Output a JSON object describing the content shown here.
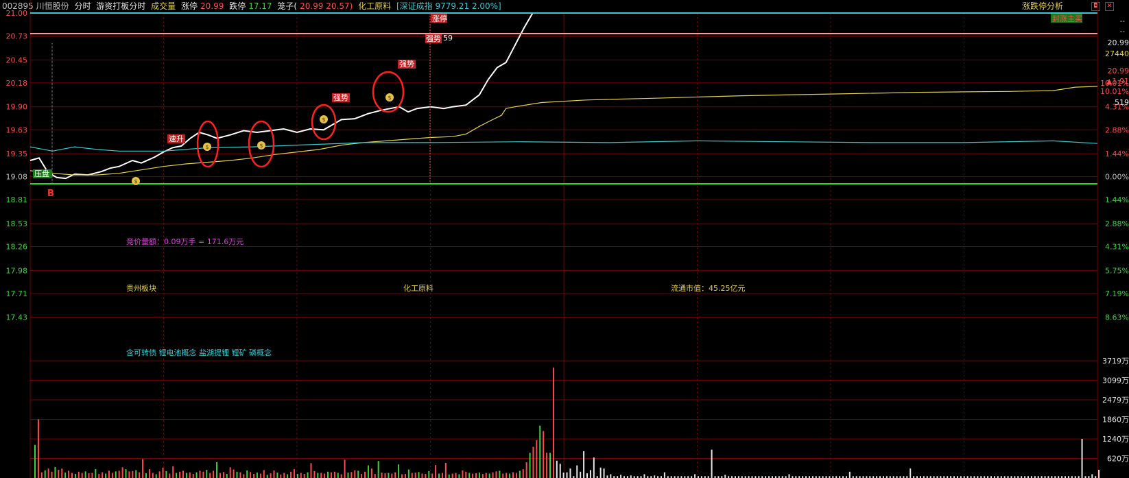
{
  "header": {
    "code": "002895 川恒股份",
    "tab_fenshi": "分时",
    "tab_youzi": "游资打板分时",
    "volume_label": "成交量",
    "zhangting_label": "涨停",
    "zhangting_value": "20.99",
    "dieting_label": "跌停",
    "dieting_value": "17.17",
    "longzi_label": "笼子(",
    "longzi_values": "20.99 20.57)",
    "sector": "化工原料",
    "index_text": "[深证成指 9779.21 2.00%]",
    "right_title": "涨跌停分析"
  },
  "colors": {
    "up": "#ff4b4b",
    "down": "#3cd23c",
    "price_line": "#ffffff",
    "avg_line": "#e6d24a",
    "cyan_line": "#39c8d2",
    "grid": "#7a0000",
    "limit_line": "#f2a0a0"
  },
  "annotations": {
    "zhangting_tag": "涨停",
    "qiangshi_top": "强势",
    "num_59": "59",
    "qiangshi_1": "强势",
    "qiangshi_2": "强势",
    "susheng": "速升",
    "yawei": "压盘",
    "b_mark": "B",
    "fengdan": "封涨主买",
    "jingjia": "竞价量额：0.09万手 = 171.6万元",
    "guizhou": "贵州板块",
    "huagong": "化工原料",
    "liutong": "流通市值：45.25亿元",
    "concepts": "含可转债 锂电池概念 盐湖提锂 锂矿 磷概念"
  },
  "right_panel": {
    "dash1": "--",
    "dash2": "--",
    "price": "20.99",
    "volume": "27440",
    "price2": "20.99",
    "change": "▲1.91",
    "pct": "10.01%",
    "num": "519"
  },
  "chart_data": {
    "type": "line",
    "pre_close": 19.08,
    "price_ticks": [
      "21.00",
      "20.73",
      "20.45",
      "20.18",
      "19.90",
      "19.63",
      "19.35",
      "19.08",
      "18.81",
      "18.53",
      "18.26",
      "17.98",
      "17.71",
      "17.43"
    ],
    "pct_ticks": [
      "",
      "",
      "",
      "10.01%",
      "4.31%",
      "2.88%",
      "1.44%",
      "0.00%",
      "1.44%",
      "2.88%",
      "4.31%",
      "5.75%",
      "7.19%",
      "8.63%"
    ],
    "ylim": [
      17.17,
      21.0
    ],
    "volume_ticks": [
      "3719万",
      "3099万",
      "2479万",
      "1860万",
      "1240万",
      "620万"
    ],
    "volume_max": 3719,
    "series": [
      {
        "kind": "price",
        "points": [
          [
            0,
            19.27
          ],
          [
            4,
            19.3
          ],
          [
            8,
            19.13
          ],
          [
            12,
            19.07
          ],
          [
            16,
            19.06
          ],
          [
            20,
            19.11
          ],
          [
            26,
            19.1
          ],
          [
            32,
            19.14
          ],
          [
            36,
            19.18
          ],
          [
            40,
            19.2
          ],
          [
            46,
            19.27
          ],
          [
            50,
            19.24
          ],
          [
            56,
            19.31
          ],
          [
            60,
            19.37
          ],
          [
            64,
            19.42
          ],
          [
            68,
            19.44
          ],
          [
            72,
            19.53
          ],
          [
            76,
            19.6
          ],
          [
            80,
            19.57
          ],
          [
            84,
            19.53
          ],
          [
            90,
            19.57
          ],
          [
            96,
            19.62
          ],
          [
            102,
            19.6
          ],
          [
            108,
            19.62
          ],
          [
            114,
            19.64
          ],
          [
            120,
            19.6
          ],
          [
            126,
            19.64
          ],
          [
            132,
            19.63
          ],
          [
            136,
            19.69
          ],
          [
            140,
            19.75
          ],
          [
            146,
            19.76
          ],
          [
            152,
            19.82
          ],
          [
            158,
            19.86
          ],
          [
            162,
            19.88
          ],
          [
            166,
            19.9
          ],
          [
            170,
            19.84
          ],
          [
            174,
            19.88
          ],
          [
            180,
            19.9
          ],
          [
            186,
            19.88
          ],
          [
            190,
            19.9
          ],
          [
            196,
            19.92
          ],
          [
            202,
            20.04
          ],
          [
            206,
            20.22
          ],
          [
            210,
            20.36
          ],
          [
            214,
            20.42
          ],
          [
            218,
            20.62
          ],
          [
            222,
            20.82
          ],
          [
            226,
            21.0
          ]
        ]
      },
      {
        "kind": "avg",
        "points": [
          [
            0,
            19.15
          ],
          [
            10,
            19.12
          ],
          [
            20,
            19.1
          ],
          [
            30,
            19.1
          ],
          [
            40,
            19.12
          ],
          [
            50,
            19.16
          ],
          [
            60,
            19.2
          ],
          [
            70,
            19.23
          ],
          [
            80,
            19.25
          ],
          [
            90,
            19.27
          ],
          [
            100,
            19.3
          ],
          [
            110,
            19.34
          ],
          [
            120,
            19.37
          ],
          [
            130,
            19.4
          ],
          [
            140,
            19.45
          ],
          [
            150,
            19.48
          ],
          [
            160,
            19.5
          ],
          [
            170,
            19.52
          ],
          [
            180,
            19.54
          ],
          [
            190,
            19.55
          ],
          [
            196,
            19.58
          ],
          [
            202,
            19.67
          ],
          [
            208,
            19.75
          ],
          [
            212,
            19.8
          ],
          [
            214,
            19.88
          ],
          [
            218,
            19.9
          ],
          [
            230,
            19.95
          ],
          [
            250,
            19.98
          ],
          [
            280,
            20.0
          ],
          [
            320,
            20.03
          ],
          [
            360,
            20.05
          ],
          [
            400,
            20.07
          ],
          [
            440,
            20.08
          ],
          [
            460,
            20.09
          ],
          [
            470,
            20.13
          ],
          [
            480,
            20.14
          ]
        ]
      },
      {
        "kind": "cyan",
        "points": [
          [
            0,
            19.43
          ],
          [
            10,
            19.38
          ],
          [
            20,
            19.43
          ],
          [
            30,
            19.4
          ],
          [
            40,
            19.38
          ],
          [
            60,
            19.38
          ],
          [
            80,
            19.42
          ],
          [
            100,
            19.43
          ],
          [
            130,
            19.46
          ],
          [
            150,
            19.48
          ],
          [
            180,
            19.48
          ],
          [
            220,
            19.49
          ],
          [
            260,
            19.48
          ],
          [
            300,
            19.5
          ],
          [
            340,
            19.49
          ],
          [
            380,
            19.48
          ],
          [
            420,
            19.48
          ],
          [
            460,
            19.5
          ],
          [
            480,
            19.47
          ]
        ]
      }
    ],
    "volume": [
      1050,
      1860,
      180,
      240,
      300,
      200,
      350,
      260,
      300,
      170,
      230,
      160,
      130,
      200,
      160,
      210,
      150,
      160,
      280,
      130,
      180,
      140,
      230,
      160,
      210,
      230,
      340,
      280,
      210,
      220,
      250,
      180,
      600,
      150,
      280,
      160,
      120,
      210,
      330,
      220,
      140,
      370,
      160,
      200,
      230,
      160,
      180,
      130,
      180,
      230,
      200,
      260,
      160,
      230,
      500,
      160,
      190,
      130,
      340,
      270,
      200,
      180,
      120,
      240,
      190,
      130,
      170,
      140,
      250,
      100,
      150,
      240,
      170,
      110,
      160,
      120,
      200,
      280,
      130,
      160,
      130,
      180,
      470,
      220,
      160,
      160,
      140,
      200,
      180,
      200,
      160,
      120,
      580,
      170,
      190,
      240,
      230,
      130,
      200,
      400,
      300,
      130,
      540,
      170,
      150,
      160,
      140,
      180,
      430,
      120,
      130,
      270,
      160,
      170,
      190,
      140,
      130,
      220,
      140,
      410,
      140,
      160,
      480,
      110,
      140,
      160,
      120,
      240,
      200,
      160,
      140,
      150,
      170,
      130,
      160,
      140,
      180,
      210,
      230,
      140,
      160,
      140,
      180,
      160,
      230,
      280,
      500,
      800,
      990,
      1200,
      1660,
      1490,
      800,
      800,
      3500,
      550,
      450,
      170,
      180,
      300,
      60,
      400,
      200,
      850,
      150,
      250,
      650,
      60,
      330,
      300,
      80,
      120,
      60,
      60,
      100,
      60,
      60,
      80,
      60,
      60,
      60,
      120,
      60,
      60,
      80,
      60,
      60,
      180,
      60,
      60,
      60,
      60,
      60,
      60,
      60,
      60,
      120,
      60,
      60,
      60,
      60,
      900,
      60,
      60,
      60,
      100,
      60,
      60,
      60,
      60,
      60,
      60,
      60,
      60,
      60,
      60,
      60,
      60,
      60,
      60,
      60,
      60,
      60,
      60,
      120,
      60,
      60,
      60,
      60,
      60,
      60,
      60,
      60,
      60,
      60,
      60,
      60,
      60,
      60,
      60,
      60,
      60,
      200,
      60,
      60,
      60,
      60,
      60,
      60,
      60,
      60,
      60,
      60,
      60,
      60,
      60,
      60,
      60,
      60,
      60,
      300,
      60,
      60,
      60,
      60,
      60,
      60,
      60,
      60,
      60,
      60,
      60,
      60,
      60,
      60,
      60,
      60,
      60,
      60,
      60,
      60,
      60,
      60,
      60,
      60,
      60,
      60,
      60,
      60,
      60,
      60,
      60,
      60,
      60,
      60,
      60,
      60,
      60,
      60,
      60,
      60,
      60,
      60,
      60,
      60,
      60,
      60,
      60,
      60,
      60,
      60,
      1240,
      60,
      60,
      120,
      60,
      260
    ]
  }
}
